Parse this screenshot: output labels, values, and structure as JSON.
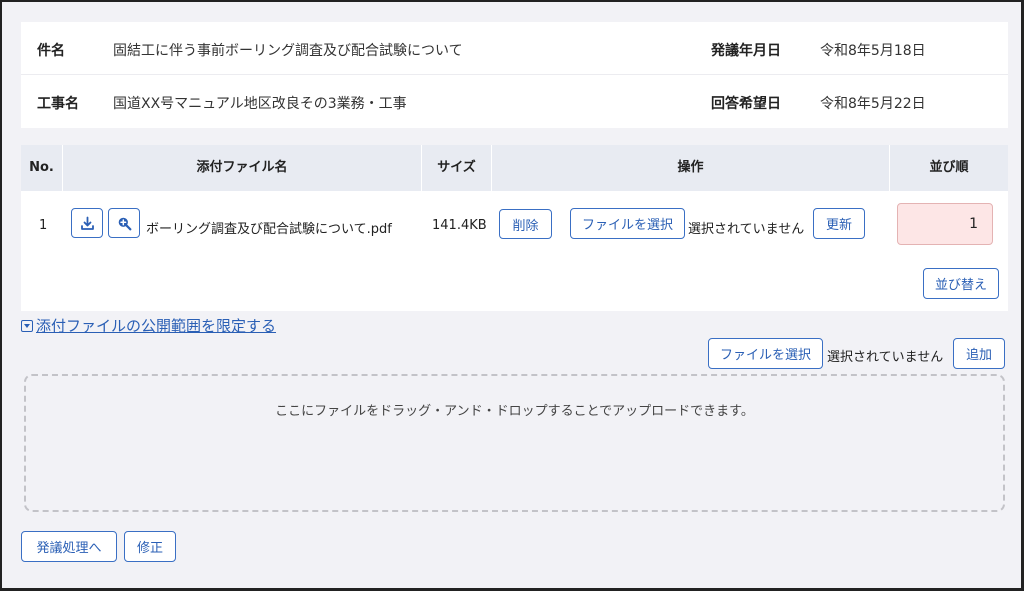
{
  "info": {
    "subject_label": "件名",
    "subject_value": "固結工に伴う事前ボーリング調査及び配合試験について",
    "issue_date_label": "発議年月日",
    "issue_date_value": "令和8年5月18日",
    "project_label": "工事名",
    "project_value": "国道XX号マニュアル地区改良その3業務・工事",
    "reply_date_label": "回答希望日",
    "reply_date_value": "令和8年5月22日"
  },
  "table": {
    "headers": {
      "no": "No.",
      "name": "添付ファイル名",
      "size": "サイズ",
      "op": "操作",
      "order": "並び順"
    },
    "rows": [
      {
        "no": "1",
        "file_name": "ボーリング調査及び配合試験について.pdf",
        "size": "141.4KB",
        "delete_label": "削除",
        "choose_label": "ファイルを選択",
        "choose_status": "選択されていません",
        "update_label": "更新",
        "order": "1"
      }
    ],
    "reorder_label": "並び替え",
    "icons": {
      "download": "download-icon",
      "preview": "zoom-in-icon"
    }
  },
  "scope": {
    "link_label": "添付ファイルの公開範囲を限定する"
  },
  "upload": {
    "choose_label": "ファイルを選択",
    "choose_status": "選択されていません",
    "add_label": "追加",
    "drop_hint": "ここにファイルをドラッグ・アンド・ドロップすることでアップロードできます。"
  },
  "footer": {
    "submit_label": "発議処理へ",
    "edit_label": "修正"
  },
  "colors": {
    "accent": "#2a5fb5",
    "header_bg": "#e8ebf2",
    "order_bg": "#fde6e6",
    "page_bg": "#f2f2f6"
  }
}
